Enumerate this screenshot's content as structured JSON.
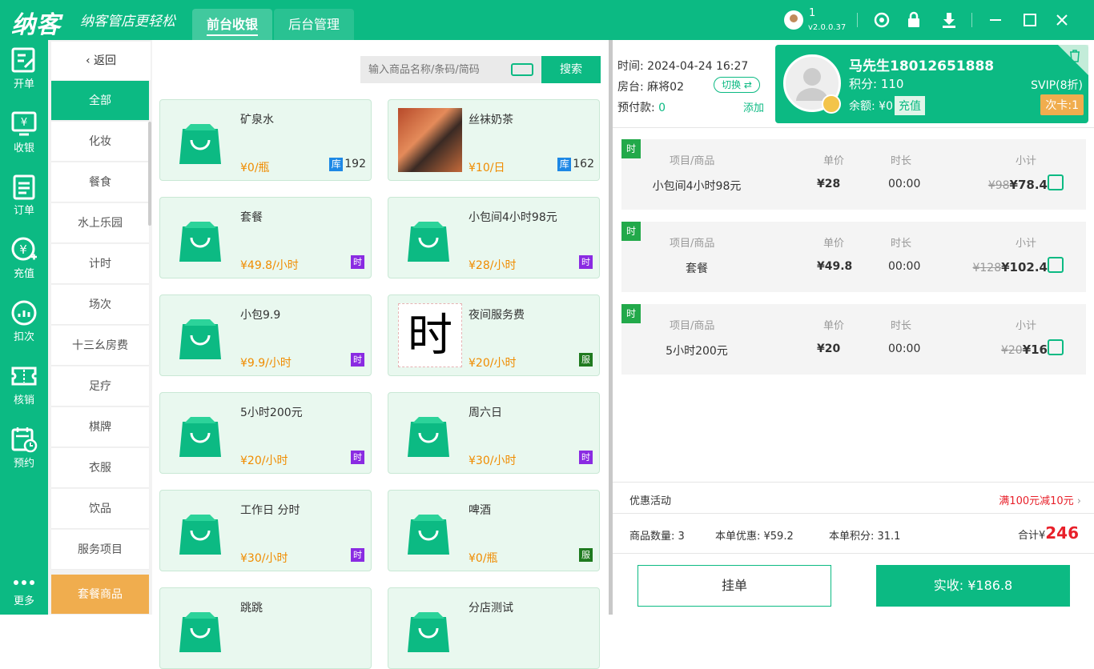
{
  "app": {
    "logo": "纳客",
    "slogan": "纳客管店更轻松",
    "user": "1",
    "version": "v2.0.0.37"
  },
  "tabs": [
    {
      "label": "前台收银"
    },
    {
      "label": "后台管理"
    }
  ],
  "nav": [
    {
      "label": "开单"
    },
    {
      "label": "收银"
    },
    {
      "label": "订单"
    },
    {
      "label": "充值"
    },
    {
      "label": "扣次"
    },
    {
      "label": "核销"
    },
    {
      "label": "预约"
    },
    {
      "label": "更多"
    }
  ],
  "back_label": "返回",
  "categories": [
    "全部",
    "化妆",
    "餐食",
    "水上乐园",
    "计时",
    "场次",
    "十三幺房费",
    "足疗",
    "棋牌",
    "衣服",
    "饮品",
    "服务项目",
    "套餐商品"
  ],
  "search": {
    "placeholder": "输入商品名称/条码/简码",
    "button": "搜索"
  },
  "products": [
    {
      "name": "矿泉水",
      "price": "¥0/瓶",
      "stock_label": "库",
      "stock": "192"
    },
    {
      "name": "丝袜奶茶",
      "price": "¥10/日",
      "stock_label": "库",
      "stock": "162"
    },
    {
      "name": "套餐",
      "price": "¥49.8/小时",
      "badge": "时"
    },
    {
      "name": "小包间4小时98元",
      "price": "¥28/小时",
      "badge": "时"
    },
    {
      "name": "小包9.9",
      "price": "¥9.9/小时",
      "badge": "时"
    },
    {
      "name": "夜间服务费",
      "price": "¥20/小时",
      "badge": "服",
      "img_text": "时"
    },
    {
      "name": "5小时200元",
      "price": "¥20/小时",
      "badge": "时"
    },
    {
      "name": "周六日",
      "price": "¥30/小时",
      "badge": "时"
    },
    {
      "name": "工作日 分时",
      "price": "¥30/小时",
      "badge": "时"
    },
    {
      "name": "啤酒",
      "price": "¥0/瓶",
      "badge": "服"
    },
    {
      "name": "跳跳",
      "price": ""
    },
    {
      "name": "分店测试",
      "price": ""
    }
  ],
  "order": {
    "time_label": "时间:",
    "time": "2024-04-24 16:27",
    "room_label": "房台:",
    "room": "麻将02",
    "switch": "切换 ⇄",
    "prepay_label": "预付款:",
    "prepay": "0",
    "add": "添加"
  },
  "member": {
    "name": "马先生18012651888",
    "points": "积分: 110",
    "balance": "余额: ¥0",
    "charge": "充值",
    "level": "SVIP(8折)",
    "card": "次卡:1"
  },
  "line_headers": {
    "item": "项目/商品",
    "price": "单价",
    "duration": "时长",
    "subtotal": "小计"
  },
  "lines": [
    {
      "tag": "时",
      "item": "小包间4小时98元",
      "price": "¥28",
      "duration": "00:00",
      "original": "¥98",
      "subtotal": "¥78.4"
    },
    {
      "tag": "时",
      "item": "套餐",
      "price": "¥49.8",
      "duration": "00:00",
      "original": "¥128",
      "subtotal": "¥102.4"
    },
    {
      "tag": "时",
      "item": "5小时200元",
      "price": "¥20",
      "duration": "00:00",
      "original": "¥20",
      "subtotal": "¥16"
    }
  ],
  "promo": {
    "label": "优惠活动",
    "value": "满100元减10元"
  },
  "summary": {
    "qty": "商品数量: 3",
    "discount": "本单优惠: ¥59.2",
    "points": "本单积分: 31.1",
    "total_label": "合计¥",
    "total": "246"
  },
  "buttons": {
    "hang": "挂单",
    "pay": "实收: ¥186.8"
  },
  "colors": {
    "brand": "#0cba83",
    "price": "#f08c00",
    "accent_red": "#e8202a",
    "orange": "#f0ad4e"
  }
}
